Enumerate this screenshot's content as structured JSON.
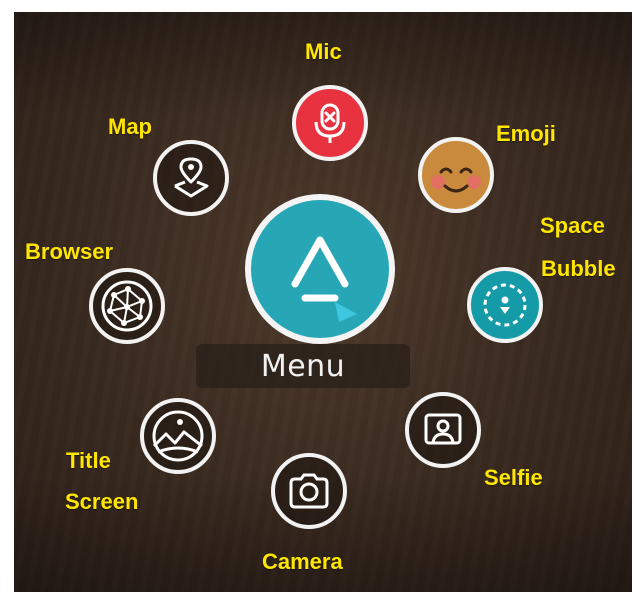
{
  "menu": {
    "label": "Menu"
  },
  "items": {
    "mic": {
      "label": "Mic",
      "icon": "mic-off-icon",
      "color": "#e9323f"
    },
    "emoji": {
      "label": "Emoji",
      "icon": "smiley-face-icon",
      "color": "#c98a3e"
    },
    "space_bubble": {
      "label_line1": "Space",
      "label_line2": "Bubble",
      "icon": "space-bubble-icon",
      "color": "#159aa8"
    },
    "selfie": {
      "label": "Selfie",
      "icon": "selfie-icon"
    },
    "camera": {
      "label": "Camera",
      "icon": "camera-icon"
    },
    "title_screen": {
      "label_line1": "Title",
      "label_line2": "Screen",
      "icon": "landscape-icon"
    },
    "browser": {
      "label": "Browser",
      "icon": "network-globe-icon"
    },
    "map": {
      "label": "Map",
      "icon": "map-pin-icon"
    }
  },
  "colors": {
    "accent": "#27a7b6",
    "label_yellow": "#ffe600"
  }
}
